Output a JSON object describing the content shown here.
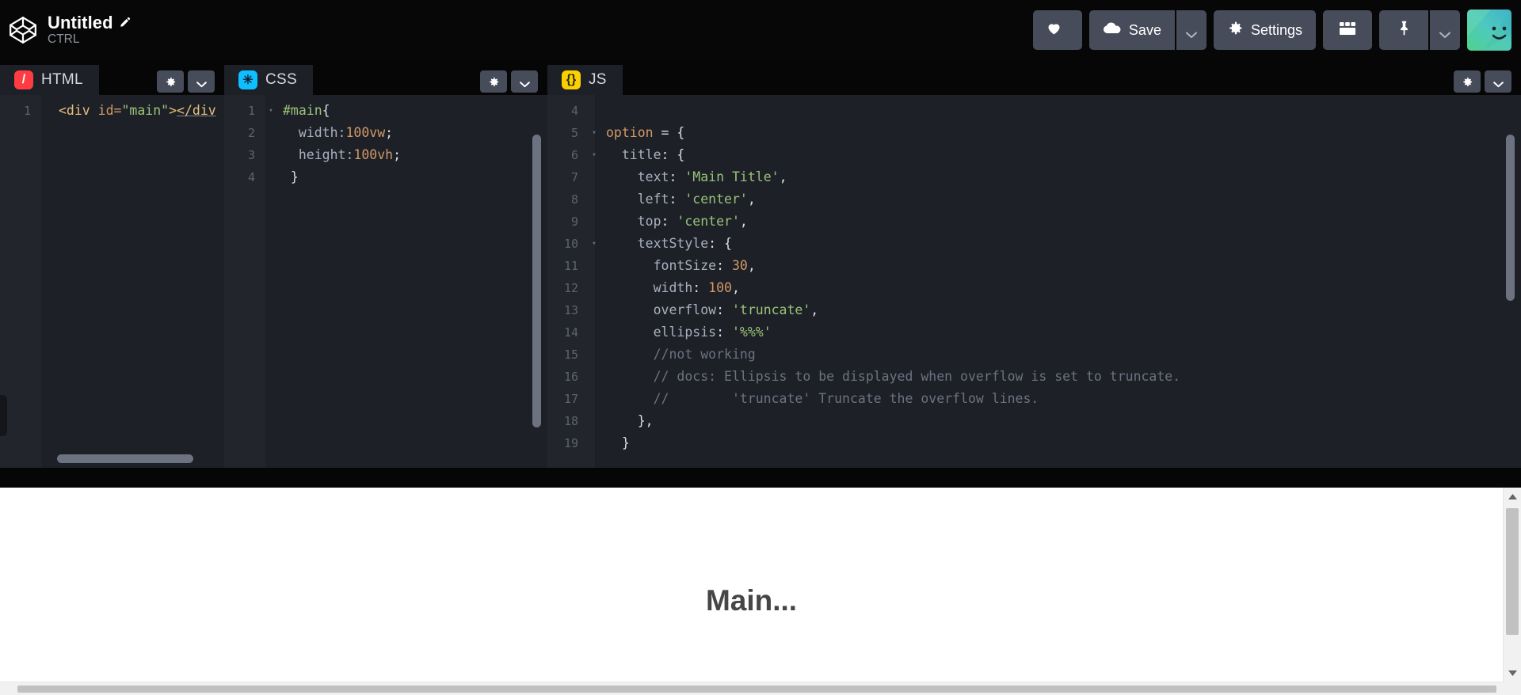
{
  "app": {
    "logo_icon": "codepen-cube-icon",
    "pen_title": "Untitled",
    "pen_title_edit_icon": "pencil-icon",
    "owner": "CTRL"
  },
  "toolbar": {
    "love_label": "",
    "love_icon": "heart-icon",
    "save_label": "Save",
    "save_icon": "cloud-icon",
    "save_caret_icon": "chevron-down-icon",
    "settings_label": "Settings",
    "settings_icon": "gear-icon",
    "layout_icon": "layout-grid-icon",
    "pin_icon": "pin-icon",
    "pin_caret_icon": "chevron-down-icon",
    "avatar_icon": "user-avatar-icon"
  },
  "panes": [
    {
      "key": "html",
      "label": "HTML",
      "icon_glyph": "/",
      "icon_name": "html-logo-icon",
      "settings_icon": "gear-icon",
      "caret_icon": "chevron-down-icon",
      "lines": [
        {
          "n": "1",
          "fold": "",
          "tokens": [
            {
              "t": "<div ",
              "c": "t-tag"
            },
            {
              "t": "id=",
              "c": "t-attr"
            },
            {
              "t": "\"main\"",
              "c": "t-str"
            },
            {
              "t": ">",
              "c": "t-tag"
            },
            {
              "t": "</div",
              "c": "t-tag underline-err"
            }
          ]
        }
      ]
    },
    {
      "key": "css",
      "label": "CSS",
      "icon_glyph": "✳",
      "icon_name": "css-logo-icon",
      "settings_icon": "gear-icon",
      "caret_icon": "chevron-down-icon",
      "lines": [
        {
          "n": "1",
          "fold": "▾",
          "tokens": [
            {
              "t": "#main",
              "c": "t-sel"
            },
            {
              "t": "{",
              "c": "t-white"
            }
          ]
        },
        {
          "n": "2",
          "fold": "",
          "tokens": [
            {
              "t": "  width:",
              "c": "t-prop"
            },
            {
              "t": "100vw",
              "c": "t-num"
            },
            {
              "t": ";",
              "c": "t-white"
            }
          ]
        },
        {
          "n": "3",
          "fold": "",
          "tokens": [
            {
              "t": "  height:",
              "c": "t-prop"
            },
            {
              "t": "100vh",
              "c": "t-num"
            },
            {
              "t": ";",
              "c": "t-white"
            }
          ]
        },
        {
          "n": "4",
          "fold": "",
          "tokens": [
            {
              "t": " }",
              "c": "t-white"
            }
          ]
        }
      ]
    },
    {
      "key": "js",
      "label": "JS",
      "icon_glyph": "{}",
      "icon_name": "js-logo-icon",
      "settings_icon": "gear-icon",
      "caret_icon": "chevron-down-icon",
      "lines": [
        {
          "n": "4",
          "fold": "",
          "tokens": []
        },
        {
          "n": "5",
          "fold": "▾",
          "tokens": [
            {
              "t": "option",
              "c": "t-var"
            },
            {
              "t": " = {",
              "c": "t-white"
            }
          ]
        },
        {
          "n": "6",
          "fold": "▾",
          "tokens": [
            {
              "t": "  title",
              "c": "t-kvk"
            },
            {
              "t": ": {",
              "c": "t-white"
            }
          ]
        },
        {
          "n": "7",
          "fold": "",
          "tokens": [
            {
              "t": "    text",
              "c": "t-kvk"
            },
            {
              "t": ": ",
              "c": "t-white"
            },
            {
              "t": "'Main Title'",
              "c": "t-str"
            },
            {
              "t": ",",
              "c": "t-white"
            }
          ]
        },
        {
          "n": "8",
          "fold": "",
          "tokens": [
            {
              "t": "    left",
              "c": "t-kvk"
            },
            {
              "t": ": ",
              "c": "t-white"
            },
            {
              "t": "'center'",
              "c": "t-str"
            },
            {
              "t": ",",
              "c": "t-white"
            }
          ]
        },
        {
          "n": "9",
          "fold": "",
          "tokens": [
            {
              "t": "    top",
              "c": "t-kvk"
            },
            {
              "t": ": ",
              "c": "t-white"
            },
            {
              "t": "'center'",
              "c": "t-str"
            },
            {
              "t": ",",
              "c": "t-white"
            }
          ]
        },
        {
          "n": "10",
          "fold": "▾",
          "tokens": [
            {
              "t": "    textStyle",
              "c": "t-kvk"
            },
            {
              "t": ": {",
              "c": "t-white"
            }
          ]
        },
        {
          "n": "11",
          "fold": "",
          "tokens": [
            {
              "t": "      fontSize",
              "c": "t-kvk"
            },
            {
              "t": ": ",
              "c": "t-white"
            },
            {
              "t": "30",
              "c": "t-num"
            },
            {
              "t": ",",
              "c": "t-white"
            }
          ]
        },
        {
          "n": "12",
          "fold": "",
          "tokens": [
            {
              "t": "      width",
              "c": "t-kvk"
            },
            {
              "t": ": ",
              "c": "t-white"
            },
            {
              "t": "100",
              "c": "t-num"
            },
            {
              "t": ",",
              "c": "t-white"
            }
          ]
        },
        {
          "n": "13",
          "fold": "",
          "tokens": [
            {
              "t": "      overflow",
              "c": "t-kvk"
            },
            {
              "t": ": ",
              "c": "t-white"
            },
            {
              "t": "'truncate'",
              "c": "t-str"
            },
            {
              "t": ",",
              "c": "t-white"
            }
          ]
        },
        {
          "n": "14",
          "fold": "",
          "tokens": [
            {
              "t": "      ellipsis",
              "c": "t-kvk"
            },
            {
              "t": ": ",
              "c": "t-white"
            },
            {
              "t": "'%%%'",
              "c": "t-str"
            }
          ]
        },
        {
          "n": "15",
          "fold": "",
          "tokens": [
            {
              "t": "      //not working",
              "c": "t-com"
            }
          ]
        },
        {
          "n": "16",
          "fold": "",
          "tokens": [
            {
              "t": "      // docs: Ellipsis to be displayed when overflow is set to truncate.",
              "c": "t-com"
            }
          ]
        },
        {
          "n": "17",
          "fold": "",
          "tokens": [
            {
              "t": "      //        'truncate' Truncate the overflow lines.",
              "c": "t-com"
            }
          ]
        },
        {
          "n": "18",
          "fold": "",
          "tokens": [
            {
              "t": "    },",
              "c": "t-white"
            }
          ]
        },
        {
          "n": "19",
          "fold": "",
          "tokens": [
            {
              "t": "  }",
              "c": "t-white"
            }
          ]
        }
      ]
    }
  ],
  "preview": {
    "rendered_title": "Main...",
    "scroll_up_icon": "triangle-up-icon",
    "scroll_down_icon": "triangle-down-icon"
  },
  "colors": {
    "chrome_bg": "#060606",
    "editor_bg": "#1e2027",
    "gutter_bg": "#23252c",
    "button_bg": "#474c5a",
    "html_accent": "#ff3c41",
    "css_accent": "#0ebeff",
    "js_accent": "#fcd000",
    "preview_bg": "#ffffff",
    "preview_text": "#464646"
  }
}
